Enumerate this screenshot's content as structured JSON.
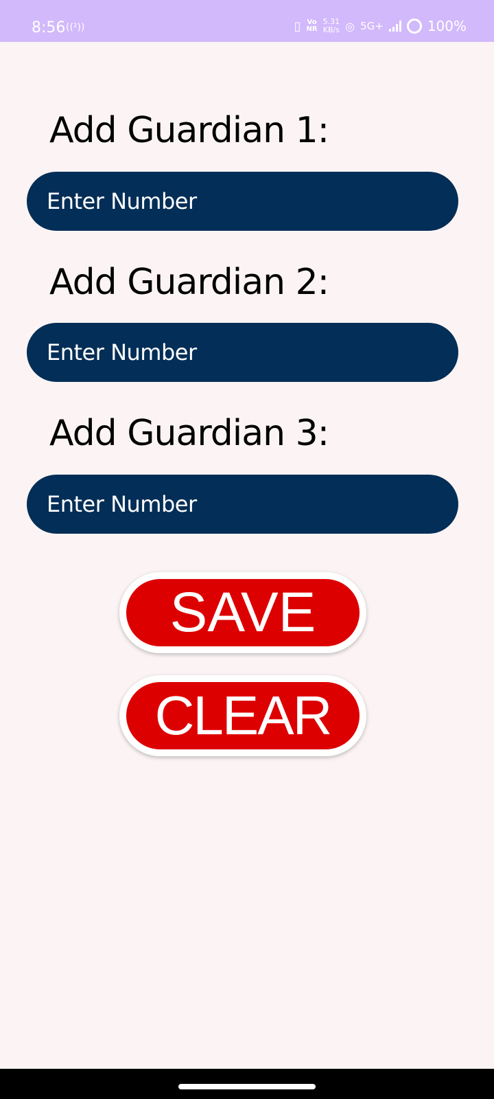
{
  "status_bar": {
    "time": "8:56",
    "hotspot_label": "((²))",
    "vonr": [
      "Vo",
      "NR"
    ],
    "speed": [
      "5.31",
      "KB/s"
    ],
    "network_type": "5G+",
    "battery_percent": "100%"
  },
  "guardians": [
    {
      "label": "Add Guardian 1:",
      "placeholder": "Enter Number"
    },
    {
      "label": "Add Guardian 2:",
      "placeholder": "Enter Number"
    },
    {
      "label": "Add Guardian 3:",
      "placeholder": "Enter Number"
    }
  ],
  "buttons": {
    "save_label": "SAVE",
    "clear_label": "CLEAR"
  },
  "colors": {
    "status_bar": "#d2b9fb",
    "background": "#fcf4f4",
    "field": "#032e57",
    "button": "#dd0000"
  }
}
